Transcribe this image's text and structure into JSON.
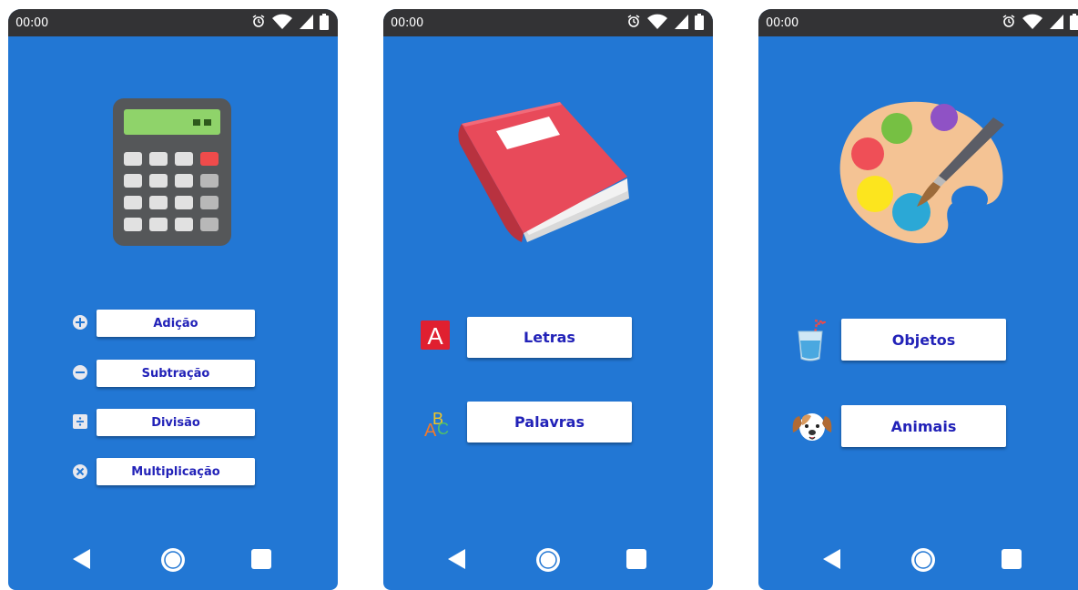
{
  "colors": {
    "screen_bg": "#2277d4",
    "statusbar_bg": "#333335",
    "button_bg": "#ffffff",
    "button_text": "#2222b8"
  },
  "screens": [
    {
      "status": {
        "time": "00:00",
        "icons": [
          "alarm-icon",
          "wifi-icon",
          "signal-icon",
          "battery-icon"
        ]
      },
      "hero_icon": "calculator-icon",
      "menu": [
        {
          "label": "Adição",
          "icon": "plus-circle-icon"
        },
        {
          "label": "Subtração",
          "icon": "minus-circle-icon"
        },
        {
          "label": "Divisão",
          "icon": "divide-square-icon"
        },
        {
          "label": "Multiplicação",
          "icon": "times-circle-icon"
        }
      ],
      "nav": [
        "back-icon",
        "home-icon",
        "recent-apps-icon"
      ]
    },
    {
      "status": {
        "time": "00:00",
        "icons": [
          "alarm-icon",
          "wifi-icon",
          "signal-icon",
          "battery-icon"
        ]
      },
      "hero_icon": "book-icon",
      "menu": [
        {
          "label": "Letras",
          "icon": "letter-a-icon",
          "icon_text": "A"
        },
        {
          "label": "Palavras",
          "icon": "abc-icon",
          "icon_text": [
            "A",
            "B",
            "C"
          ]
        }
      ],
      "nav": [
        "back-icon",
        "home-icon",
        "recent-apps-icon"
      ]
    },
    {
      "status": {
        "time": "00:00",
        "icons": [
          "alarm-icon",
          "wifi-icon",
          "signal-icon",
          "battery-icon"
        ]
      },
      "hero_icon": "paint-palette-icon",
      "menu": [
        {
          "label": "Objetos",
          "icon": "cup-with-straw-icon"
        },
        {
          "label": "Animais",
          "icon": "dog-face-icon"
        }
      ],
      "nav": [
        "back-icon",
        "home-icon",
        "recent-apps-icon"
      ]
    }
  ]
}
